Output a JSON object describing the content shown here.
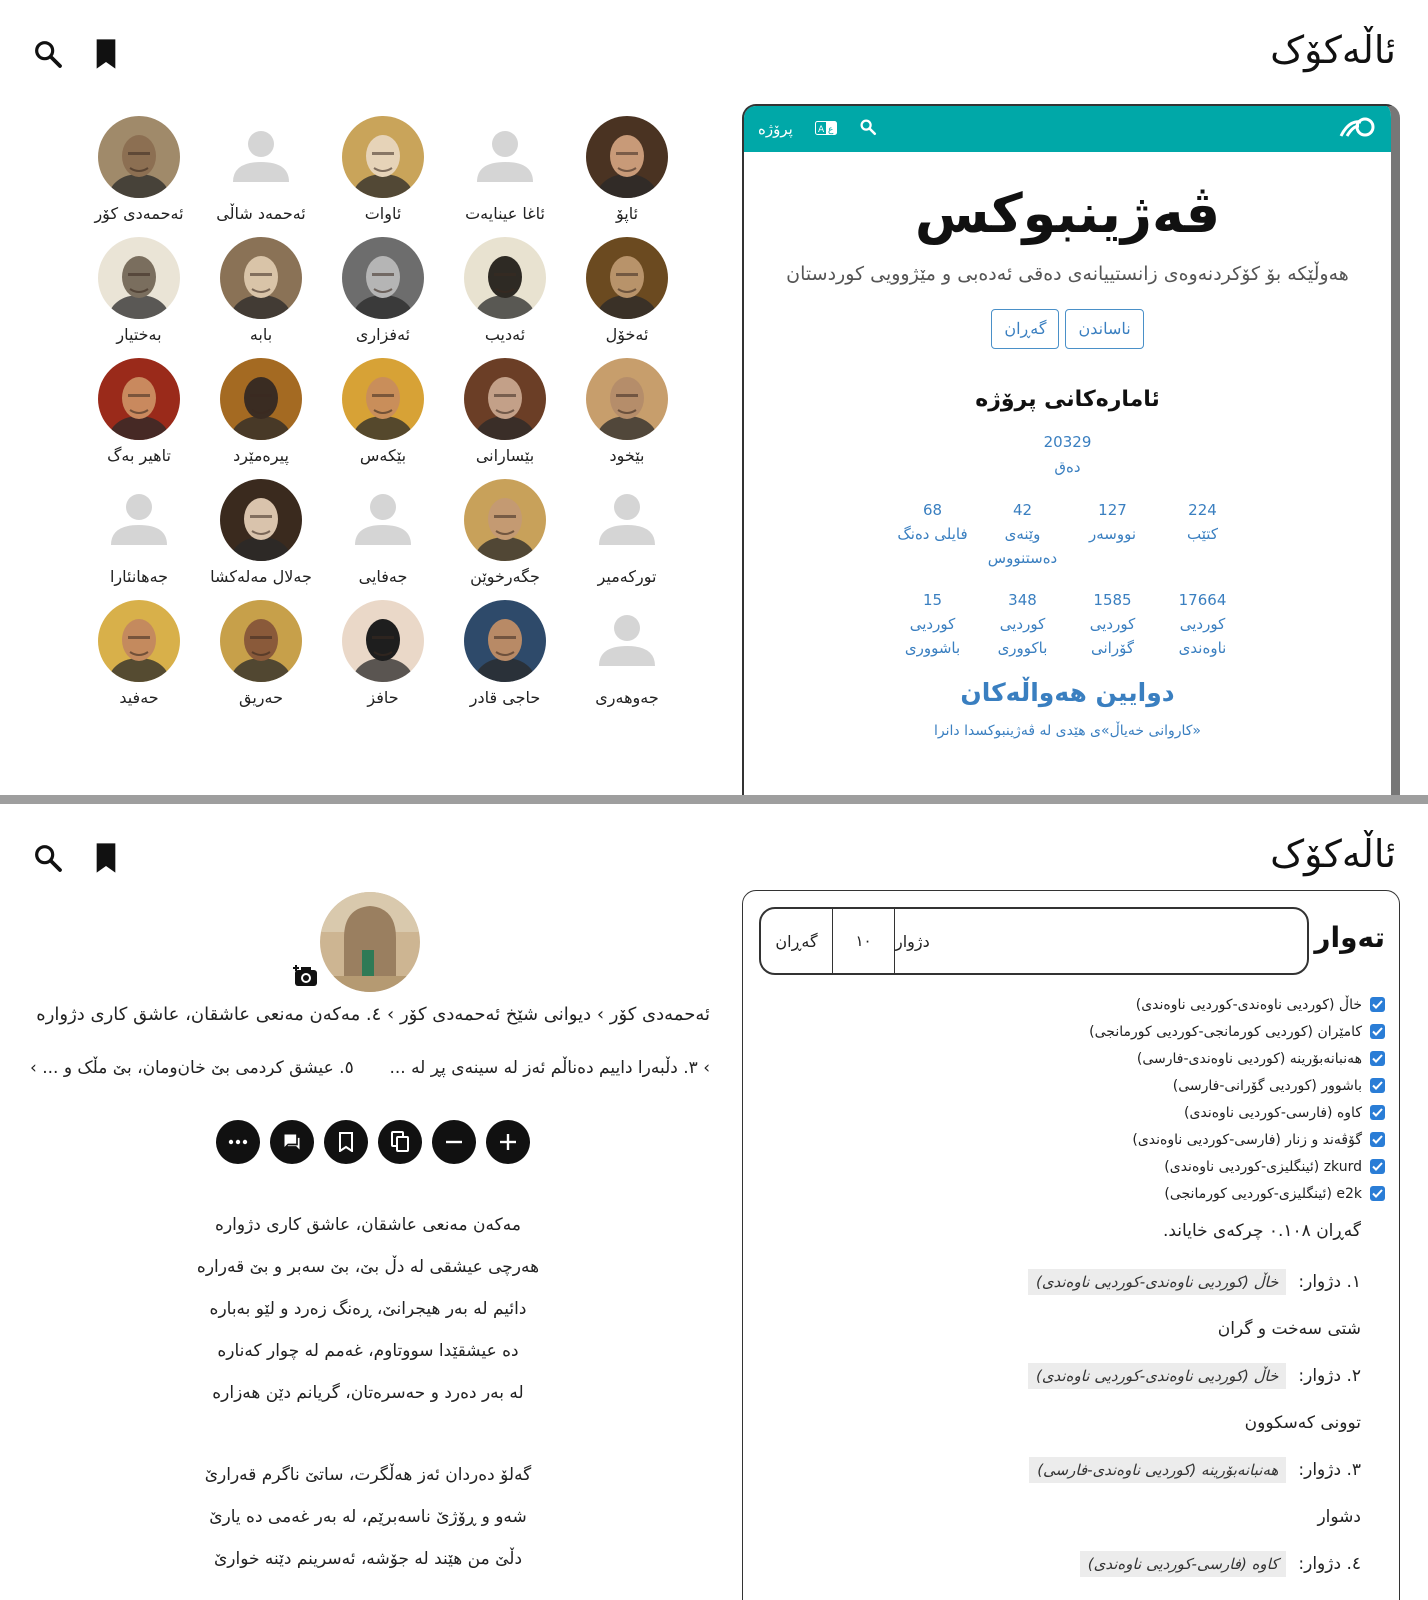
{
  "app_title": "ئاڵەکۆک",
  "poets": [
    {
      "name": "ئاپۆ",
      "photo": true,
      "bg": "#4a3322",
      "face": "#c89a78"
    },
    {
      "name": "ئاغا عینایەت",
      "photo": false
    },
    {
      "name": "ئاوات",
      "photo": true,
      "bg": "#c9a45a",
      "face": "#e6d3b8"
    },
    {
      "name": "ئەحمەد شاڵی",
      "photo": false
    },
    {
      "name": "ئەحمەدی کۆر",
      "photo": true,
      "bg": "#a08a6a",
      "face": "#8c6f52"
    },
    {
      "name": "ئەخۆل",
      "photo": true,
      "bg": "#6b4a20",
      "face": "#b8936a"
    },
    {
      "name": "ئەدیب",
      "photo": true,
      "bg": "#e8e2d0",
      "face": "#2e2a24"
    },
    {
      "name": "ئەفزاری",
      "photo": true,
      "bg": "#6d6d6d",
      "face": "#b5b5b5"
    },
    {
      "name": "بابە",
      "photo": true,
      "bg": "#8a7256",
      "face": "#d9c4a8"
    },
    {
      "name": "بەختیار",
      "photo": true,
      "bg": "#eae4d6",
      "face": "#7a6e5e"
    },
    {
      "name": "بێخود",
      "photo": true,
      "bg": "#c79e6c",
      "face": "#b58d6a"
    },
    {
      "name": "بێسارانی",
      "photo": true,
      "bg": "#6b3e26",
      "face": "#c3a088"
    },
    {
      "name": "بێکەس",
      "photo": true,
      "bg": "#d7a236",
      "face": "#c98e5a"
    },
    {
      "name": "پیرەمێرد",
      "photo": true,
      "bg": "#a46a22",
      "face": "#3a2c22"
    },
    {
      "name": "تاهیر بەگ",
      "photo": true,
      "bg": "#9a2a1a",
      "face": "#c9895e"
    },
    {
      "name": "تورکەمیر",
      "photo": false
    },
    {
      "name": "جگەرخوێن",
      "photo": true,
      "bg": "#c8a15a",
      "face": "#c49a72"
    },
    {
      "name": "جەفایی",
      "photo": false
    },
    {
      "name": "جەلال مەلەکشا",
      "photo": true,
      "bg": "#3a2a1e",
      "face": "#d9c3ac"
    },
    {
      "name": "جەهانئارا",
      "photo": false
    },
    {
      "name": "جەوهەری",
      "photo": false
    },
    {
      "name": "حاجی قادر",
      "photo": true,
      "bg": "#2e4a6a",
      "face": "#b88a66"
    },
    {
      "name": "حافز",
      "photo": true,
      "bg": "#ead8c8",
      "face": "#1e1e1e"
    },
    {
      "name": "حەریق",
      "photo": true,
      "bg": "#c7a04a",
      "face": "#8a5a3a"
    },
    {
      "name": "حەفید",
      "photo": true,
      "bg": "#d8b04a",
      "face": "#c48a5e"
    }
  ],
  "vejin": {
    "bar_text": "پرۆژە",
    "title": "ڤەژینبوکس",
    "description": "هەوڵێکە بۆ کۆکردنەوەی زانستییانەی دەقی ئەدەبی و مێژوویی کوردستان",
    "btn_intro": "ناساندن",
    "btn_search": "گەڕان",
    "stats_heading": "ئامارەکانی پرۆژە",
    "total": {
      "value": "20329",
      "label": "دەق"
    },
    "stats_row1": [
      {
        "value": "224",
        "label": "کتێب"
      },
      {
        "value": "127",
        "label": "نووسەر"
      },
      {
        "value": "42",
        "label": "وێنەی دەستنووس"
      },
      {
        "value": "68",
        "label": "فایلی دەنگ"
      }
    ],
    "stats_row2": [
      {
        "value": "17664",
        "label": "کوردیی ناوەندی"
      },
      {
        "value": "1585",
        "label": "کوردیی گۆرانی"
      },
      {
        "value": "348",
        "label": "کوردیی باکووری"
      },
      {
        "value": "15",
        "label": "کوردیی باشووری"
      }
    ],
    "news_heading": "دوایین هەواڵەکان",
    "news_item": "«کاروانی خەیاڵ»ی هێدی لە ڤەژینبوکسدا دانرا"
  },
  "poem": {
    "breadcrumb": "ئەحمەدی کۆر › دیوانی شێخ ئەحمەدی کۆر › ٤. مەکەن مەنعی عاشقان، عاشق کاری دژوارە",
    "prev": "› ٣. دڵبەرا داییم دەناڵم ئەز لە سینەی پڕ لە ...",
    "next": "٥. عیشق کردمی بێ خان‌ومان، بێ مڵک و ... ›",
    "stanza1": [
      "مەکەن مەنعی عاشقان، عاشق کاری دژوارە",
      "هەرچی عیشقی لە دڵ بێ، بێ سەبر و بێ قەرارە",
      "دائیم لە بەر هیجرانێ، ڕەنگ زەرد و لێو بەبارە",
      "دە عیشقێدا سووتاوم، غەمم لە چوار کەنارە",
      "لە بەر دەرد و حەسرەتان، گریانم دێن هەزارە"
    ],
    "stanza2": [
      "گەلۆ دەردان ئەز هەڵگرت، ساتێ ناگرم قەرارێ",
      "شەو و ڕۆژێ ناسەبرێم، لە بەر غەمی دە یارێ",
      "دڵێ من هێند لە جۆشە، ئەسرینم دێنە خوارێ"
    ]
  },
  "dictionary": {
    "label": "تەوار",
    "query": "دژوار",
    "count": "١٠",
    "search_btn": "گەڕان",
    "sources": [
      "خاڵ (کوردیی ناوەندی-کوردیی ناوەندی)",
      "کامێران (کوردیی کورمانجی-کوردیی کورمانجی)",
      "هەنبانەبۆرینە (کوردیی ناوەندی-فارسی)",
      "باشوور (کوردیی گۆرانی-فارسی)",
      "کاوە (فارسی-کوردیی ناوەندی)",
      "گۆڤەند و زنار (فارسی-کوردیی ناوەندی)",
      "zkurd (ئینگلیزی-کوردیی ناوەندی)",
      "e2k (ئینگلیزی-کوردیی کورمانجی)"
    ],
    "summary": "گەڕان ٠.١٠٨ چرکەی خایاند.",
    "results": [
      {
        "no": "١. دژوار:",
        "src": "خاڵ (کوردیی ناوەندی-کوردیی ناوەندی)",
        "meaning": "شتی سەخت و گران"
      },
      {
        "no": "٢. دژوار:",
        "src": "خاڵ (کوردیی ناوەندی-کوردیی ناوەندی)",
        "meaning": "توونی کەسکوون"
      },
      {
        "no": "٣. دژوار:",
        "src": "هەنبانەبۆرینە (کوردیی ناوەندی-فارسی)",
        "meaning": "دشوار"
      },
      {
        "no": "٤. دژوار:",
        "src": "کاوە (فارسی-کوردیی ناوەندی)",
        "meaning": ""
      }
    ]
  }
}
